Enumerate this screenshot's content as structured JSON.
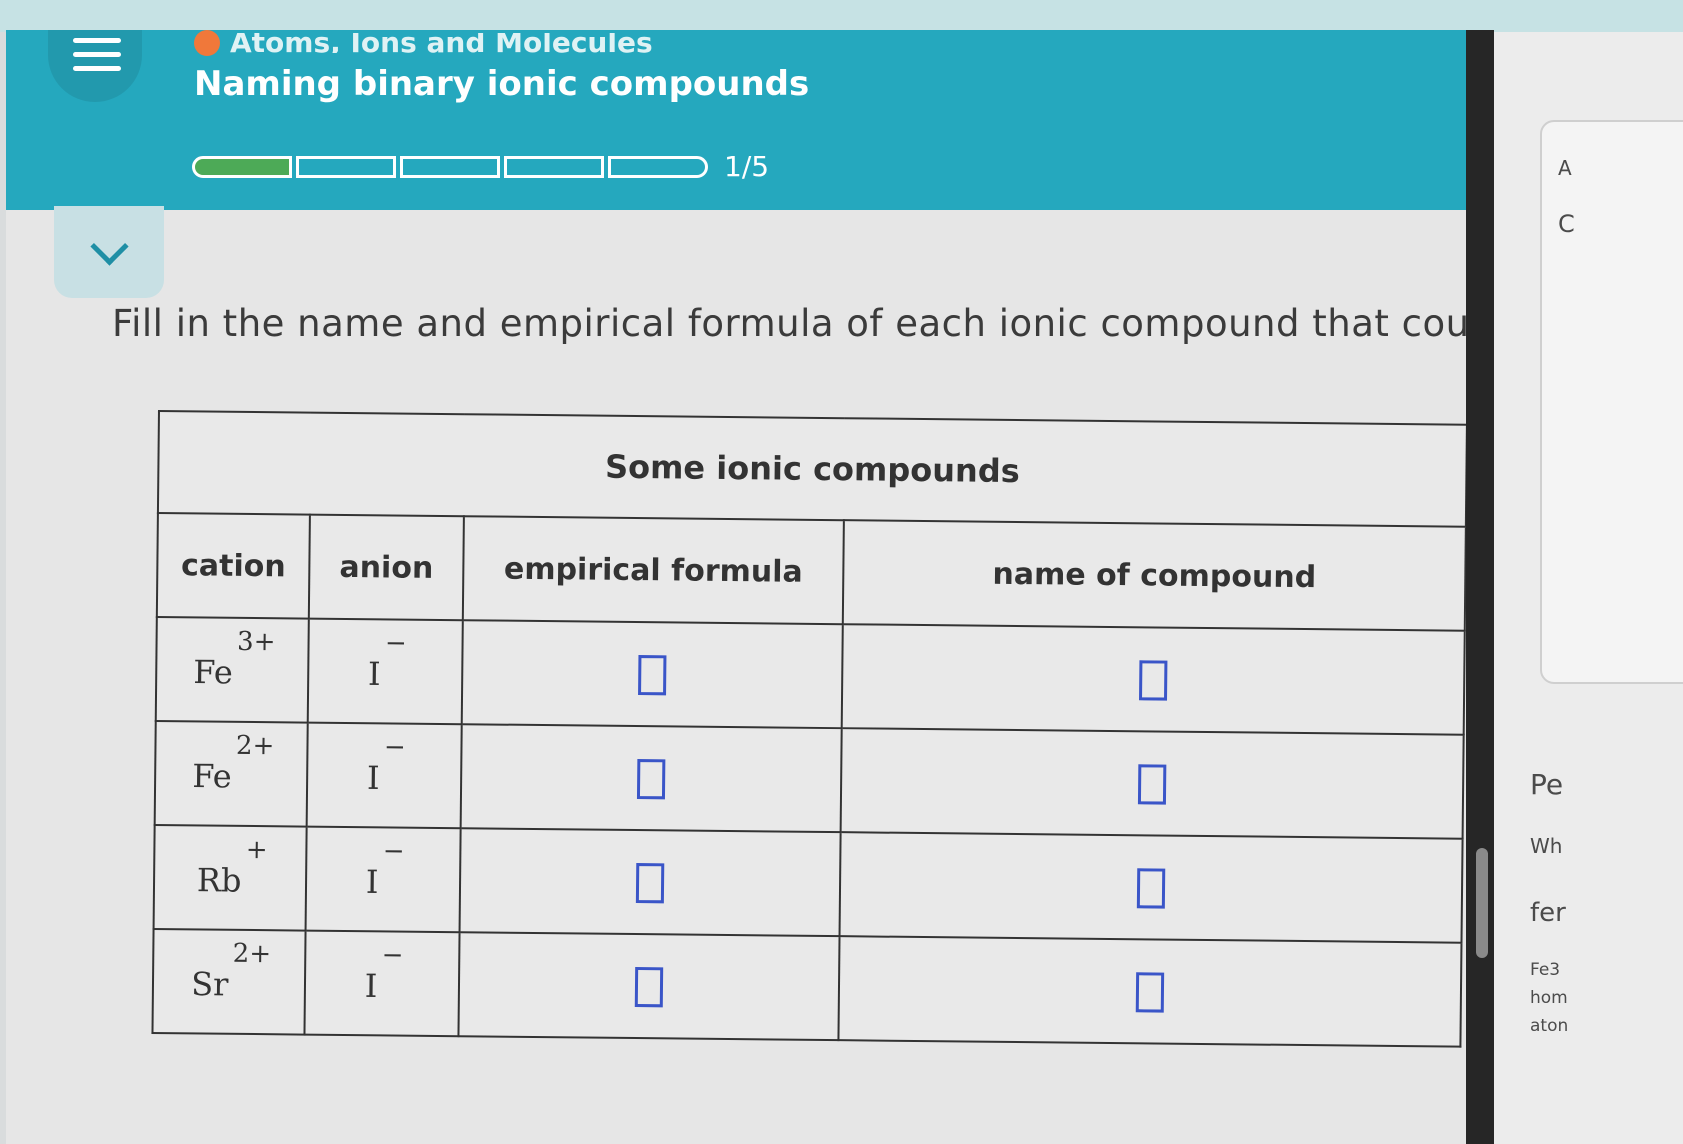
{
  "header": {
    "topic": "Atoms, Ions and Molecules",
    "title": "Naming binary ionic compounds",
    "progress": {
      "completed": 1,
      "total": 5,
      "label": "1/5"
    }
  },
  "instruction": "Fill in the name and empirical formula of each ionic compound that could be f",
  "table": {
    "caption": "Some ionic compounds",
    "columns": [
      "cation",
      "anion",
      "empirical formula",
      "name of compound"
    ],
    "rows": [
      {
        "cation": "Fe",
        "cation_charge": "3+",
        "anion": "I",
        "anion_charge": "−"
      },
      {
        "cation": "Fe",
        "cation_charge": "2+",
        "anion": "I",
        "anion_charge": "−"
      },
      {
        "cation": "Rb",
        "cation_charge": "+",
        "anion": "I",
        "anion_charge": "−"
      },
      {
        "cation": "Sr",
        "cation_charge": "2+",
        "anion": "I",
        "anion_charge": "−"
      }
    ]
  },
  "side_panel": {
    "fragments": [
      "A",
      "C",
      "Pe",
      "Wh",
      "fer",
      "Fe3",
      "hom",
      "aton"
    ]
  },
  "colors": {
    "header": "#25a8be",
    "progress_fill": "#4daa57",
    "topic_dot": "#f0783a",
    "answer_box": "#3a55c8"
  }
}
